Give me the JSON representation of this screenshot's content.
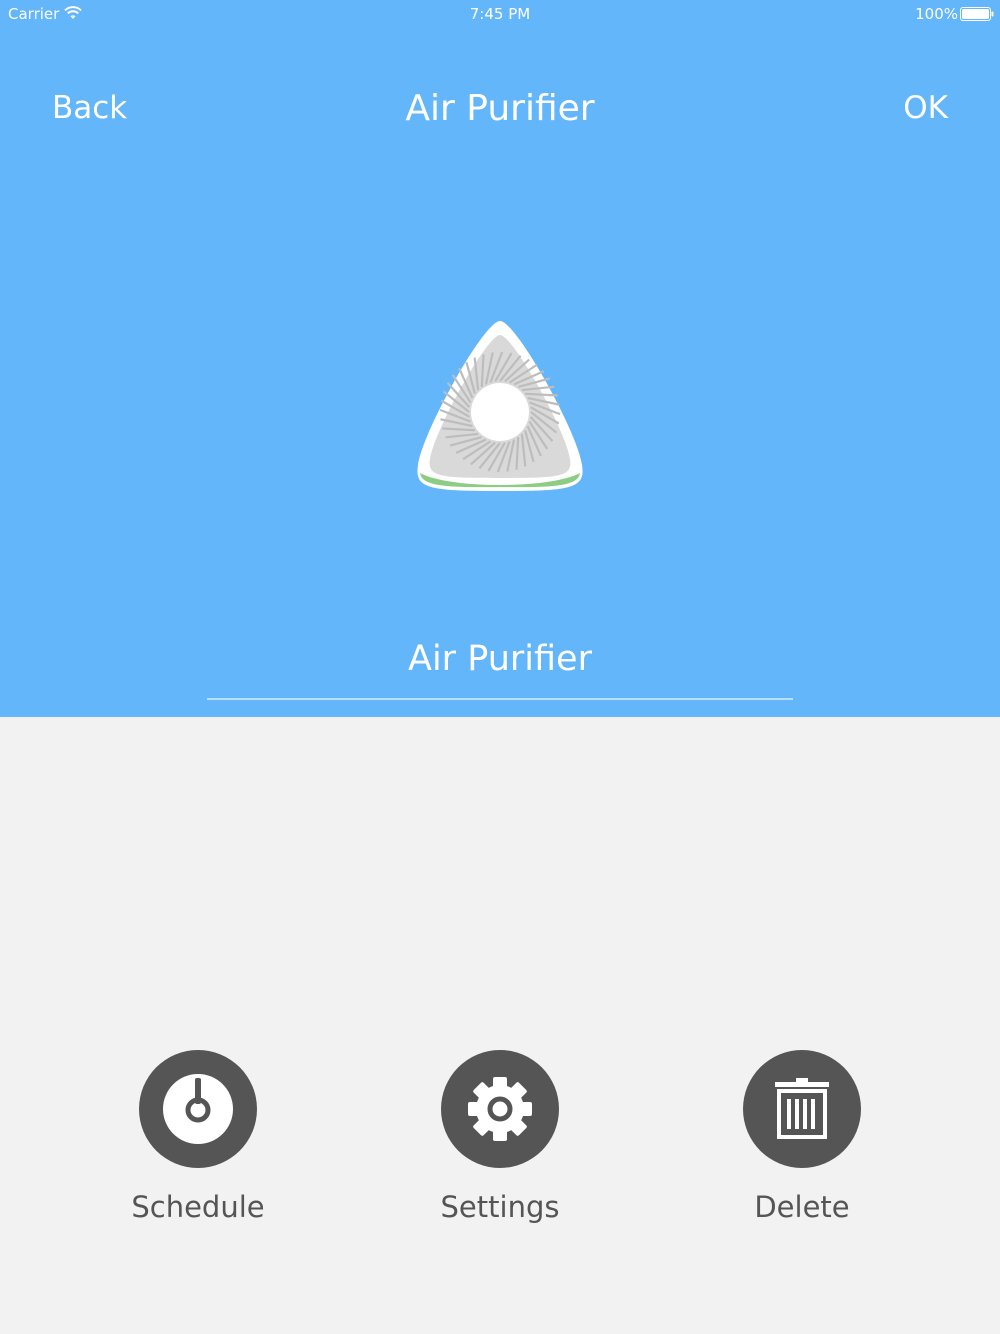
{
  "status_bar": {
    "carrier": "Carrier",
    "time": "7:45 PM",
    "battery": "100%"
  },
  "nav": {
    "back_label": "Back",
    "title": "Air Purifier",
    "ok_label": "OK"
  },
  "device": {
    "icon": "air-purifier-icon",
    "name_value": "Air Purifier"
  },
  "actions": [
    {
      "label": "Schedule",
      "icon": "schedule-icon"
    },
    {
      "label": "Settings",
      "icon": "gear-icon"
    },
    {
      "label": "Delete",
      "icon": "trash-icon"
    }
  ],
  "colors": {
    "header_bg": "#63b6fa",
    "body_bg": "#f2f2f2",
    "action_circle": "#555555",
    "text_on_header": "#ffffff"
  }
}
